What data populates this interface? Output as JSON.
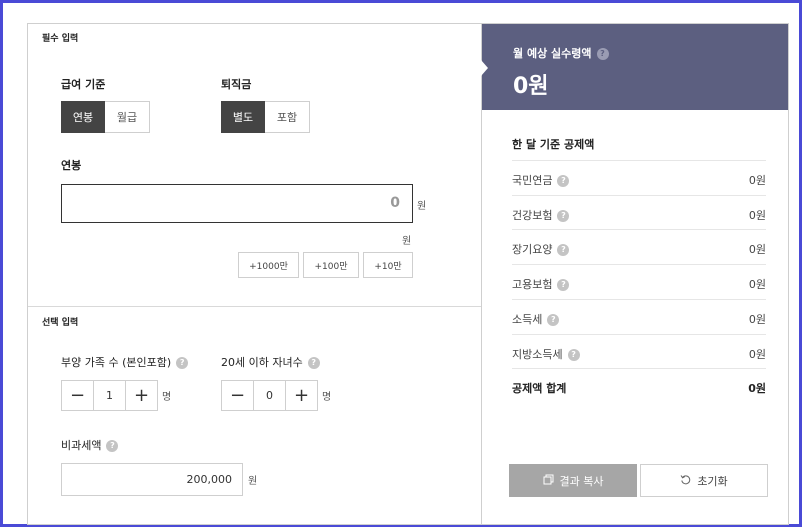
{
  "required": {
    "title": "필수 입력",
    "salary_basis": {
      "label": "급여 기준",
      "options": [
        "연봉",
        "월급"
      ],
      "selected": "연봉"
    },
    "severance": {
      "label": "퇴직금",
      "options": [
        "별도",
        "포함"
      ],
      "selected": "별도"
    },
    "annual": {
      "label": "연봉",
      "value": "0",
      "unit": "원",
      "sub_unit": "원"
    },
    "quick_add": [
      "+1000만",
      "+100만",
      "+10만"
    ]
  },
  "optional": {
    "title": "선택 입력",
    "dependents": {
      "label": "부양 가족 수 (본인포함)",
      "value": "1",
      "unit": "명"
    },
    "children": {
      "label": "20세 이하 자녀수",
      "value": "0",
      "unit": "명"
    },
    "nontax": {
      "label": "비과세액",
      "value": "200,000",
      "unit": "원"
    }
  },
  "result": {
    "title": "월 예상 실수령액",
    "amount": "0원",
    "deduction_title": "한 달 기준 공제액",
    "rows": [
      {
        "name": "국민연금",
        "value": "0원"
      },
      {
        "name": "건강보험",
        "value": "0원"
      },
      {
        "name": "장기요양",
        "value": "0원"
      },
      {
        "name": "고용보험",
        "value": "0원"
      },
      {
        "name": "소득세",
        "value": "0원"
      },
      {
        "name": "지방소득세",
        "value": "0원"
      }
    ],
    "total": {
      "name": "공제액 합계",
      "value": "0원"
    },
    "copy_label": "결과 복사",
    "reset_label": "초기화"
  },
  "icons": {
    "help": "?",
    "minus": "−",
    "plus": "+",
    "copy": "copy-icon",
    "reset": "reset-icon"
  },
  "colors": {
    "header": "#5c5f80",
    "active": "#444444",
    "frame": "#4a4ad6",
    "copy_button": "#a6a6a6"
  }
}
